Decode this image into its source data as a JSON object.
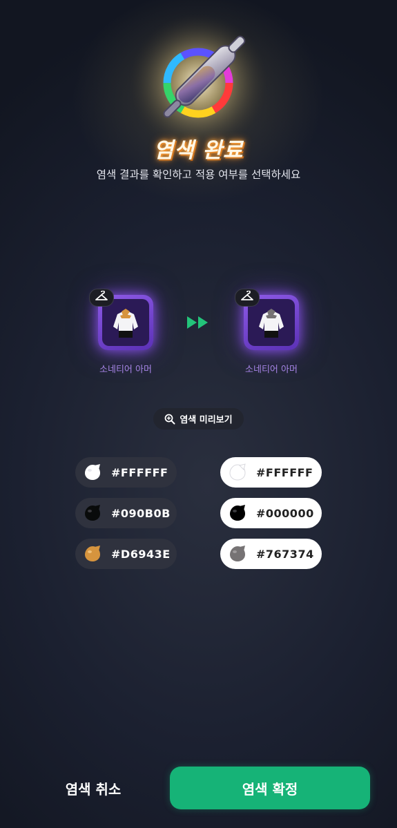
{
  "header": {
    "title": "염색 완료",
    "subtitle": "염색 결과를 확인하고 적용 여부를 선택하세요"
  },
  "items": {
    "before": {
      "name": "소네티어 아머"
    },
    "after": {
      "name": "소네티어 아머"
    }
  },
  "preview": {
    "label": "염색 미리보기"
  },
  "colors": {
    "before": [
      "#FFFFFF",
      "#090B0B",
      "#D6943E"
    ],
    "after": [
      "#FFFFFF",
      "#000000",
      "#767374"
    ]
  },
  "footer": {
    "cancel_label": "염색 취소",
    "confirm_label": "염색 확정"
  },
  "accent": {
    "confirm": "#16b377",
    "item_frame": "#7a47d8"
  },
  "icons": {
    "emblem": "dye-bottle-rainbow-ring-icon",
    "hanger": "hanger-icon",
    "arrows": "double-arrow-right-icon",
    "preview": "zoom-in-icon",
    "drop": "dye-drop-icon"
  }
}
